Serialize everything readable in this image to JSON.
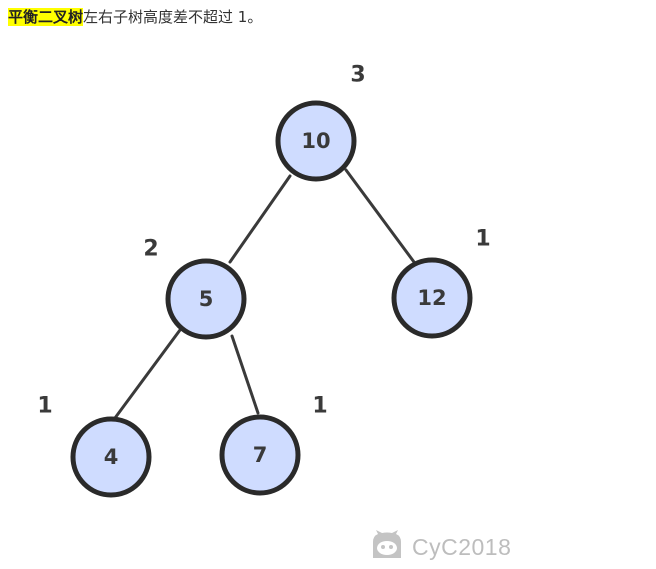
{
  "caption": {
    "highlight": "平衡二叉树",
    "text": "左右子树高度差不超过 1。"
  },
  "tree": {
    "nodes": {
      "n10": {
        "label": "10",
        "height": "3"
      },
      "n5": {
        "label": "5",
        "height": "2"
      },
      "n12": {
        "label": "12",
        "height": "1"
      },
      "n4": {
        "label": "4",
        "height": "1"
      },
      "n7": {
        "label": "7",
        "height": "1"
      }
    }
  },
  "watermark": {
    "text": "CyC2018"
  },
  "colors": {
    "node_fill": "#cfdcff",
    "node_stroke": "#2a2a2a",
    "highlight": "#ffff00",
    "watermark": "#bdbdbd"
  }
}
